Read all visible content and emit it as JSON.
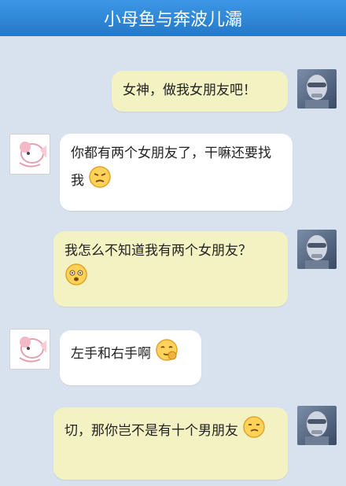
{
  "header": {
    "title": "小母鱼与奔波儿灞"
  },
  "messages": [
    {
      "side": "right",
      "text": "女神，做我女朋友吧！",
      "emoji": ""
    },
    {
      "side": "left",
      "text": "你都有两个女朋友了，干嘛还要找我",
      "emoji": "annoyed-emoji"
    },
    {
      "side": "right",
      "text": "我怎么不知道我有两个女朋友？",
      "emoji": "shocked-emoji"
    },
    {
      "side": "left",
      "text": "左手和右手啊",
      "emoji": "thinking-emoji"
    },
    {
      "side": "right",
      "text": "切，那你岂不是有十个男朋友",
      "emoji": "smug-emoji"
    }
  ]
}
